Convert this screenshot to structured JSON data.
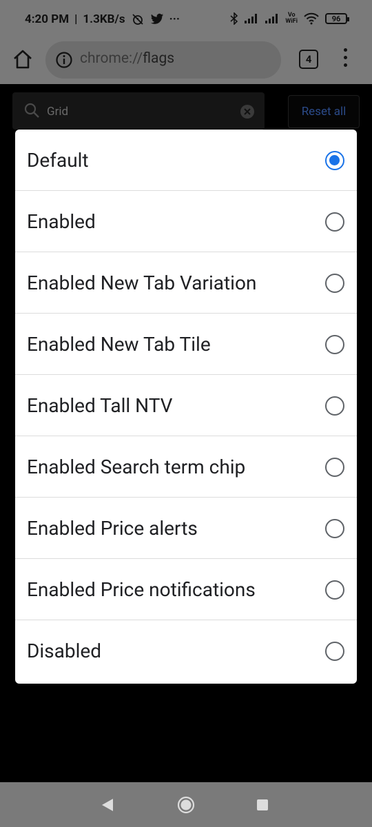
{
  "status_bar": {
    "time": "4:20 PM",
    "speed": "1.3KB/s",
    "more": "···",
    "volte_top": "Vo",
    "volte_bottom": "WiFi",
    "battery": "96"
  },
  "toolbar": {
    "url_scheme": "chrome://",
    "url_path": "flags",
    "tab_count": "4"
  },
  "page": {
    "search_value": "Grid",
    "reset_label": "Reset all"
  },
  "dialog": {
    "options": [
      {
        "label": "Default",
        "selected": true
      },
      {
        "label": "Enabled",
        "selected": false
      },
      {
        "label": "Enabled New Tab Variation",
        "selected": false
      },
      {
        "label": "Enabled New Tab Tile",
        "selected": false
      },
      {
        "label": "Enabled Tall NTV",
        "selected": false
      },
      {
        "label": "Enabled Search term chip",
        "selected": false
      },
      {
        "label": "Enabled Price alerts",
        "selected": false
      },
      {
        "label": "Enabled Price notifications",
        "selected": false
      },
      {
        "label": "Disabled",
        "selected": false
      }
    ]
  },
  "colors": {
    "accent": "#1a73e8",
    "scrim": "#7a7a7a",
    "radio_unchecked": "#5f6368"
  },
  "icons": {
    "home": "home-icon",
    "info": "info-icon",
    "menu": "more-vert-icon",
    "search": "search-icon",
    "clear": "clear-icon",
    "nav_back": "back-triangle-icon",
    "nav_home": "home-circle-icon",
    "nav_recents": "recents-square-icon"
  }
}
